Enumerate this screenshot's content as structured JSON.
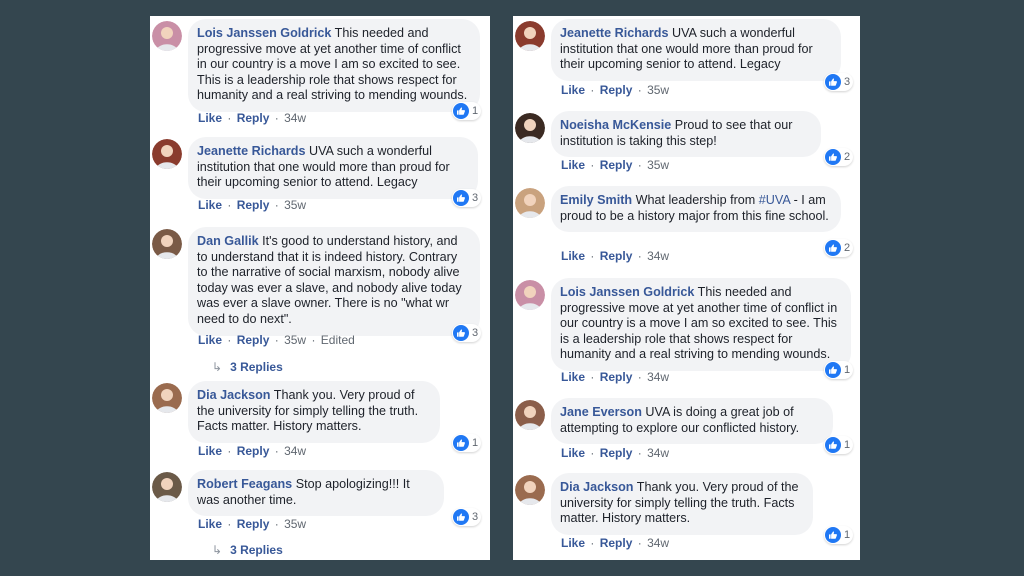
{
  "colors": {
    "background": "#34464f",
    "author_link": "#385898",
    "bubble": "#f2f3f5",
    "like_badge": "#2078f4"
  },
  "labels": {
    "like": "Like",
    "reply": "Reply",
    "separator": "·"
  },
  "left_column": [
    {
      "author": "Lois Janssen Goldrick",
      "text": "This needed and progressive move at yet another time of conflict in our country is a move I am so excited to see. This is a leadership role that shows respect for humanity and a real striving to mending wounds.",
      "reactions": "1",
      "time": "34w",
      "avatar_color": "#c98fa6"
    },
    {
      "author": "Jeanette Richards",
      "text": "UVA such a wonderful institution that one would more than proud for their upcoming senior to attend. Legacy",
      "reactions": "3",
      "time": "35w",
      "avatar_color": "#8a3b2d"
    },
    {
      "author": "Dan Gallik",
      "text": "It's good to understand history, and to understand that it is indeed history. Contrary to the narrative of social marxism, nobody alive today was ever a slave, and nobody alive today was ever a slave owner. There is no \"what wr need to do next\".",
      "reactions": "3",
      "time": "35w",
      "edited": "Edited",
      "replies": "3 Replies",
      "avatar_color": "#7a5a46"
    },
    {
      "author": "Dia Jackson",
      "text": "Thank you. Very proud of the university for simply telling the truth. Facts matter. History matters.",
      "reactions": "1",
      "time": "34w",
      "avatar_color": "#9a6b4f"
    },
    {
      "author": "Robert Feagans",
      "text": "Stop apologizing!!! It was another time.",
      "reactions": "3",
      "time": "35w",
      "replies": "3 Replies",
      "avatar_color": "#6b5a48"
    }
  ],
  "right_column": [
    {
      "author": "Jeanette Richards",
      "text": "UVA such a wonderful institution that one would more than proud for their upcoming senior to attend. Legacy",
      "reactions": "3",
      "time": "35w",
      "avatar_color": "#8a3b2d"
    },
    {
      "author": "Noeisha McKensie",
      "text": "Proud to see that our institution is taking this step!",
      "reactions": "2",
      "time": "35w",
      "avatar_color": "#3b2a22"
    },
    {
      "author": "Emily Smith",
      "text_before": "What leadership from ",
      "hashtag": "#UVA",
      "text_after": " - I am proud to be a history major from this fine school.",
      "reactions": "2",
      "time": "34w",
      "avatar_color": "#c9a27e"
    },
    {
      "author": "Lois Janssen Goldrick",
      "text": "This needed and progressive move at yet another time of conflict in our country is a move I am so excited to see. This is a leadership role that shows respect for humanity and a real striving to mending wounds.",
      "reactions": "1",
      "time": "34w",
      "avatar_color": "#c98fa6"
    },
    {
      "author": "Jane Everson",
      "text": "UVA is doing a great job of attempting to explore our conflicted history.",
      "reactions": "1",
      "time": "34w",
      "avatar_color": "#8b5e4a"
    },
    {
      "author": "Dia Jackson",
      "text": "Thank you. Very proud of the university for simply telling the truth. Facts matter. History matters.",
      "reactions": "1",
      "time": "34w",
      "avatar_color": "#9a6b4f"
    }
  ]
}
